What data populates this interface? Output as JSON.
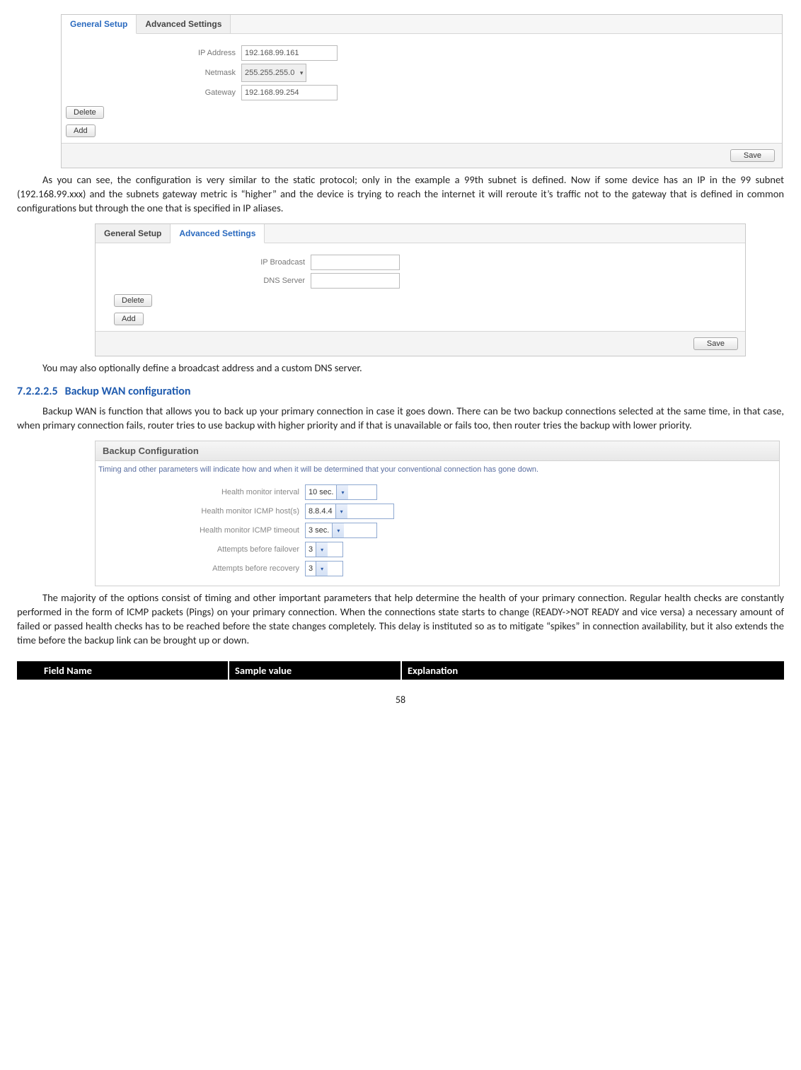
{
  "screenshot1": {
    "tabs": {
      "general": "General Setup",
      "advanced": "Advanced Settings"
    },
    "fields": {
      "ip_address_label": "IP Address",
      "ip_address_value": "192.168.99.161",
      "netmask_label": "Netmask",
      "netmask_value": "255.255.255.0",
      "gateway_label": "Gateway",
      "gateway_value": "192.168.99.254"
    },
    "delete_btn": "Delete",
    "add_btn": "Add",
    "save_btn": "Save"
  },
  "para1": "As you can see, the configuration is very similar to the static protocol; only in the example a 99th subnet is defined. Now if some device has an IP in the 99 subnet (192.168.99.xxx) and the subnets gateway metric is “higher” and the device is trying to reach the internet it will reroute it’s traffic not to the gateway that is defined in common configurations but through the one that is specified in IP aliases.",
  "screenshot2": {
    "tabs": {
      "general": "General Setup",
      "advanced": "Advanced Settings"
    },
    "fields": {
      "ip_broadcast_label": "IP Broadcast",
      "dns_server_label": "DNS Server"
    },
    "delete_btn": "Delete",
    "add_btn": "Add",
    "save_btn": "Save"
  },
  "para2": "You may also optionally define a broadcast address and a custom DNS server.",
  "section": {
    "number": "7.2.2.2.5",
    "title": "Backup WAN configuration"
  },
  "para3": "Backup WAN is function that allows you to back up your primary connection in case it goes down. There can be two backup connections selected at the same time, in that case, when primary connection fails, router tries to use backup with higher priority and if that is unavailable or fails too, then router tries the backup with lower priority.",
  "backup": {
    "title": "Backup Configuration",
    "desc": "Timing and other parameters will indicate how and when it will be determined that your conventional connection has gone down.",
    "rows": {
      "interval_label": "Health monitor interval",
      "interval_value": "10 sec.",
      "hosts_label": "Health monitor ICMP host(s)",
      "hosts_value": "8.8.4.4",
      "timeout_label": "Health monitor ICMP timeout",
      "timeout_value": "3 sec.",
      "failover_label": "Attempts before failover",
      "failover_value": "3",
      "recovery_label": "Attempts before recovery",
      "recovery_value": "3"
    }
  },
  "para4": "The majority of the options consist of timing and other important parameters that help determine the health of your primary connection. Regular health checks are constantly performed in the form of ICMP packets (Pings) on your primary connection. When the connections state starts to change (READY->NOT READY and vice versa) a necessary amount of failed or passed health checks has to be reached before the state changes completely. This delay is instituted so as to mitigate “spikes” in connection availability, but it also extends the time before the backup link can be brought up or down.",
  "table_head": {
    "c1": "Field Name",
    "c2": "Sample value",
    "c3": "Explanation"
  },
  "page_number": "58"
}
